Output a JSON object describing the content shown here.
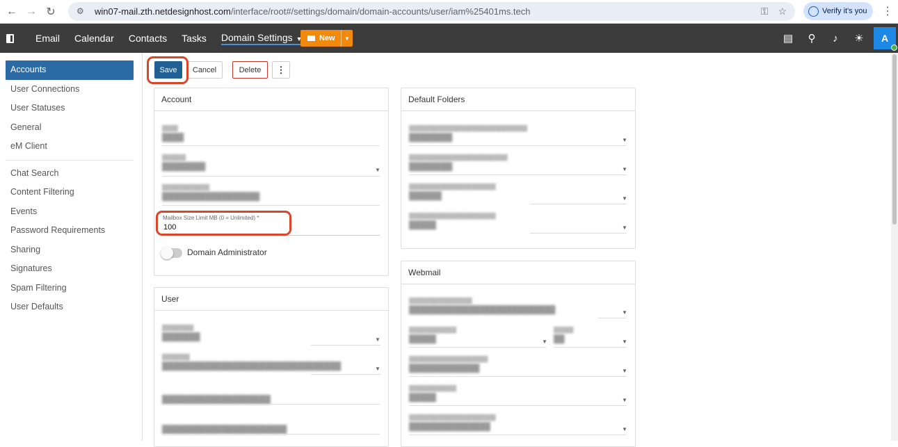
{
  "browser": {
    "url_host": "win07-mail.zth.netdesignhost.com",
    "url_path": "/interface/root#/settings/domain/domain-accounts/user/iam%25401ms.tech",
    "verify_label": "Verify it's you"
  },
  "topnav": {
    "links": [
      {
        "label": "Email"
      },
      {
        "label": "Calendar"
      },
      {
        "label": "Contacts"
      },
      {
        "label": "Tasks"
      },
      {
        "label": "Domain Settings"
      }
    ],
    "new_label": "New",
    "avatar_letter": "A"
  },
  "sidebar": {
    "group1": [
      {
        "label": "Accounts"
      },
      {
        "label": "User Connections"
      },
      {
        "label": "User Statuses"
      },
      {
        "label": "General"
      },
      {
        "label": "eM Client"
      }
    ],
    "group2": [
      {
        "label": "Chat Search"
      },
      {
        "label": "Content Filtering"
      },
      {
        "label": "Events"
      },
      {
        "label": "Password Requirements"
      },
      {
        "label": "Sharing"
      },
      {
        "label": "Signatures"
      },
      {
        "label": "Spam Filtering"
      },
      {
        "label": "User Defaults"
      }
    ]
  },
  "toolbar": {
    "save_label": "Save",
    "cancel_label": "Cancel",
    "delete_label": "Delete",
    "more_label": "⋮"
  },
  "account_card": {
    "title": "Account",
    "mailbox_label": "Mailbox Size Limit MB (0 = Unlimited) *",
    "mailbox_value": "100",
    "domain_admin_label": "Domain Administrator"
  },
  "user_card": {
    "title": "User"
  },
  "default_folders_card": {
    "title": "Default Folders"
  },
  "webmail_card": {
    "title": "Webmail"
  },
  "colors": {
    "accent": "#1f5f94",
    "annotation": "#d9472b",
    "new_button": "#f0890c",
    "topnav": "#3c3c3c"
  }
}
